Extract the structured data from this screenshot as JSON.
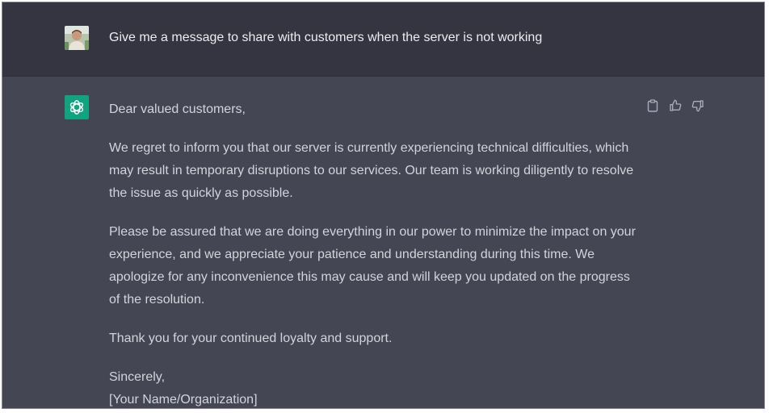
{
  "conversation": {
    "user_message": {
      "avatar": "user-photo-avatar",
      "text": "Give me a message to share with customers when the server is not working"
    },
    "assistant_message": {
      "avatar": "chatgpt-logo-icon",
      "greeting": "Dear valued customers,",
      "para1": "We regret to inform you that our server is currently experiencing technical difficulties, which may result in temporary disruptions to our services. Our team is working diligently to resolve the issue as quickly as possible.",
      "para2": "Please be assured that we are doing everything in our power to minimize the impact on your experience, and we appreciate your patience and understanding during this time. We apologize for any inconvenience this may cause and will keep you updated on the progress of the resolution.",
      "para3": "Thank you for your continued loyalty and support.",
      "closing": "Sincerely,",
      "signature": "[Your Name/Organization]"
    },
    "actions": [
      "copy-icon",
      "thumbs-up-icon",
      "thumbs-down-icon"
    ]
  },
  "colors": {
    "user_row_bg": "#343541",
    "assistant_row_bg": "#444654",
    "user_text": "#ececf1",
    "assistant_text": "#d1d5db",
    "brand_green": "#10a37f",
    "icon_gray": "#acacbe"
  }
}
